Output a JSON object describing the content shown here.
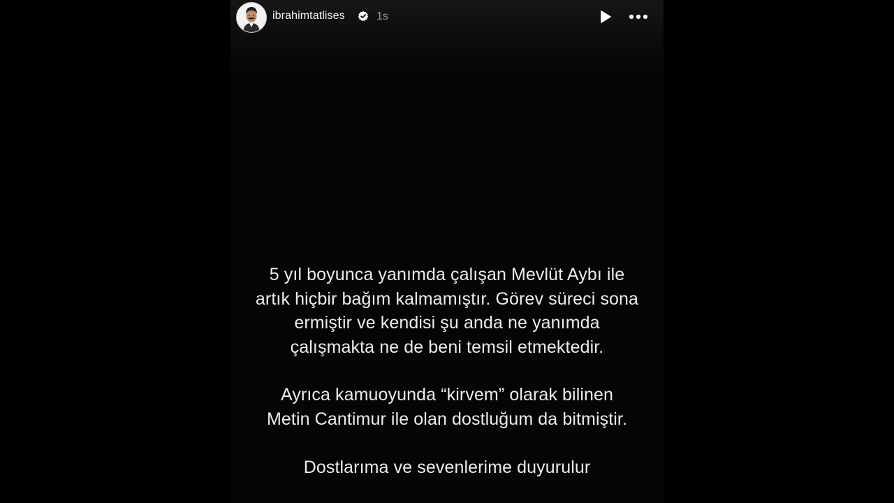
{
  "header": {
    "username": "ibrahimtatlises",
    "time": "1s",
    "icons": {
      "avatar": "profile-avatar",
      "verified": "verified-badge-icon",
      "play": "play-icon",
      "more": "more-options-icon"
    }
  },
  "message": {
    "paragraph1": [
      "5 yıl boyunca yanımda çalışan Mevlüt Aybı ile",
      "artık hiçbir bağım kalmamıştır. Görev süreci sona",
      "ermiştir ve kendisi şu anda ne yanımda",
      "çalışmakta ne de beni temsil etmektedir."
    ],
    "paragraph2": [
      "Ayrıca kamuoyunda “kirvem” olarak bilinen",
      "Metin Cantimur ile olan dostluğum da bitmiştir."
    ],
    "paragraph3": [
      "Dostlarıma ve sevenlerime duyurulur"
    ]
  },
  "colors": {
    "background": "#000000",
    "story_background": "#050505",
    "text": "#ececec",
    "muted": "#9a9a9a"
  }
}
